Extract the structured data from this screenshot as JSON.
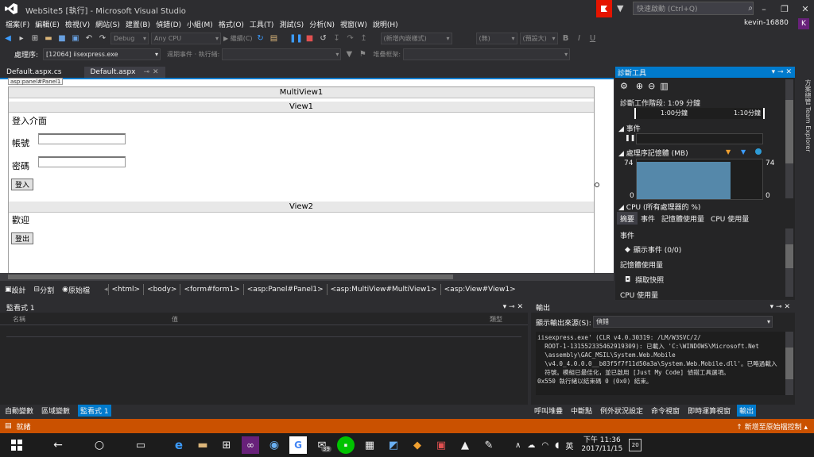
{
  "window": {
    "title": "WebSite5 [執行] - Microsoft Visual Studio",
    "quick_launch": "快速啟動 (Ctrl+Q)",
    "user": "kevin-16880",
    "avatar_letter": "K"
  },
  "menu": [
    "檔案(F)",
    "編輯(E)",
    "檢視(V)",
    "網站(S)",
    "建置(B)",
    "偵錯(D)",
    "小組(M)",
    "格式(O)",
    "工具(T)",
    "測試(S)",
    "分析(N)",
    "視窗(W)",
    "說明(H)"
  ],
  "toolbar": {
    "config": "Debug",
    "platform": "Any CPU",
    "continue": "▶ 繼續(C)",
    "style": "(新增內嵌樣式)",
    "none": "(無)",
    "default": "(預設大)"
  },
  "toolbar2": {
    "process_label": "處理序:",
    "process": "[12064] iisexpress.exe",
    "lifecycle": "週期事件 · 執行緒:",
    "stack": "堆疊框架:"
  },
  "doctabs": [
    {
      "label": "Default.aspx.cs"
    },
    {
      "label": "Default.aspx",
      "active": true
    }
  ],
  "design": {
    "panel_tag": "asp:panel#Panel1",
    "multiview": "MultiView1",
    "view1": "View1",
    "login_title": "登入介面",
    "account": "帳號",
    "password": "密碼",
    "login_btn": "登入",
    "view2": "View2",
    "welcome": "歡迎",
    "logout_btn": "登出"
  },
  "view_modes": [
    "設計",
    "分割",
    "原始檔"
  ],
  "tag_path": [
    "<html>",
    "<body>",
    "<form#form1>",
    "<asp:Panel#Panel1>",
    "<asp:MultiView#MultiView1>",
    "<asp:View#View1>"
  ],
  "diag": {
    "title": "診斷工具",
    "session": "診斷工作階段: 1:09 分鐘",
    "t1": "1:00分鐘",
    "t2": "1:10分鐘",
    "events": "事件",
    "memory": "處理序記憶體 (MB)",
    "mem_max": "74",
    "mem_min": "0",
    "cpu": "CPU (所有處理器的 %)",
    "tabs": [
      "摘要",
      "事件",
      "記憶體使用量",
      "CPU 使用量"
    ],
    "s_events": "事件",
    "show_events": "顯示事件 (0/0)",
    "s_mem": "記憶體使用量",
    "snapshot": "擷取快照",
    "s_cpu": "CPU 使用量"
  },
  "side_tabs": "方案總管 Team Explorer",
  "watch": {
    "title": "監看式 1",
    "col_name": "名稱",
    "col_value": "值",
    "col_type": "類型"
  },
  "output": {
    "title": "輸出",
    "src_label": "顯示輸出來源(S):",
    "src": "偵錯",
    "lines": [
      "iisexpress.exe' (CLR v4.0.30319: /LM/W3SVC/2/",
      "  ROOT-1-131552335462919309): 已載入 'C:\\WINDOWS\\Microsoft.Net",
      "  \\assembly\\GAC_MSIL\\System.Web.Mobile",
      "  \\v4.0_4.0.0.0__b03f5f7f11d50a3a\\System.Web.Mobile.dll'。已略過載入",
      "  符號。模組已最佳化，並已啟用 [Just My Code] 偵錯工具選項。",
      "0x550 執行緒以結束碼 0 (0x0) 結束。"
    ]
  },
  "bottom_left_tabs": [
    "自動變數",
    "區域變數",
    "監看式 1"
  ],
  "bottom_right_tabs": [
    "呼叫堆疊",
    "中斷點",
    "例外狀況設定",
    "命令視窗",
    "即時運算視窗",
    "輸出"
  ],
  "status": {
    "left": "就緒",
    "right": "新增至原始檔控制"
  },
  "taskbar": {
    "time": "下午 11:36",
    "date": "2017/11/15",
    "ime": "英",
    "badge": "39",
    "notif": "20"
  }
}
